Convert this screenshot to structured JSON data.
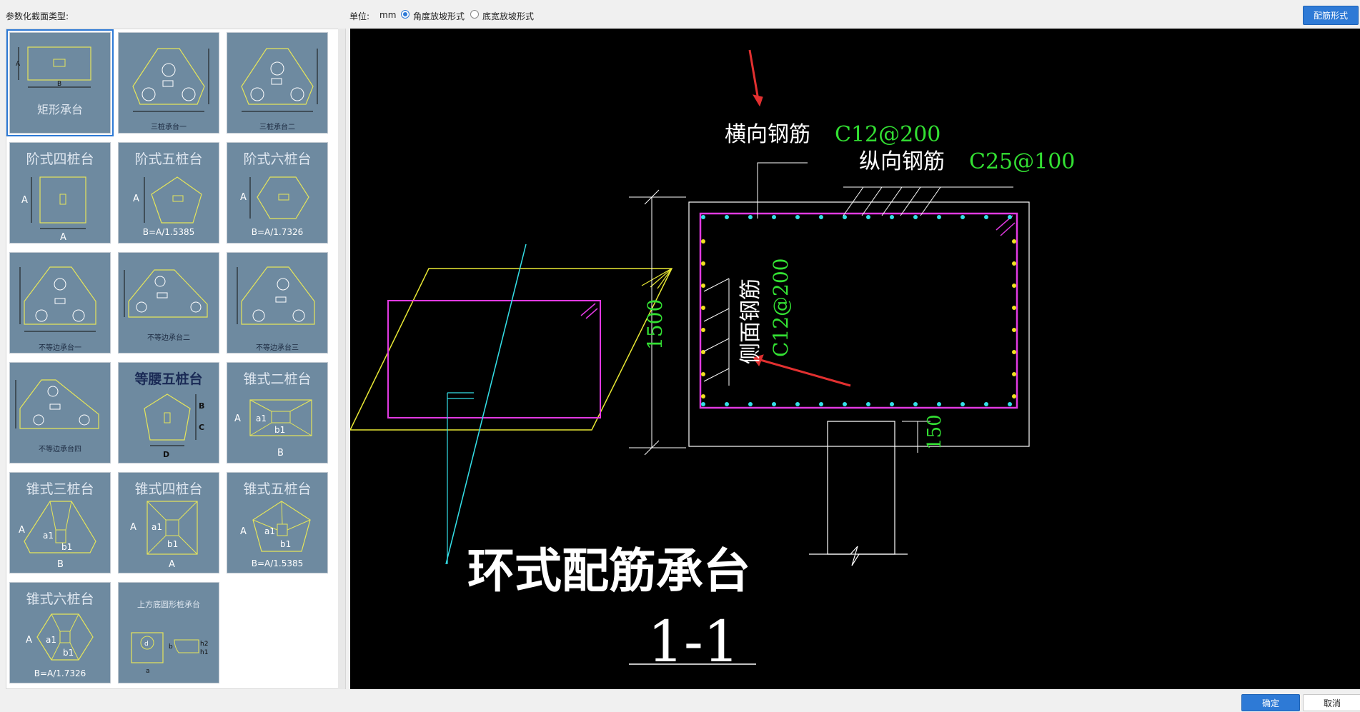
{
  "toolbar": {
    "section_type_label": "参数化截面类型:",
    "unit_label": "单位:",
    "unit_value": "mm",
    "option_angle": "角度放坡形式",
    "option_width": "底宽放坡形式",
    "rebar_form_button": "配筋形式"
  },
  "tiles": [
    {
      "title": "矩形承台"
    },
    {
      "title": "",
      "subtitle": "三桩承台一"
    },
    {
      "title": "",
      "subtitle": "三桩承台二"
    },
    {
      "title": "阶式四桩台",
      "formula": ""
    },
    {
      "title": "阶式五桩台",
      "formula": "B=A/1.5385"
    },
    {
      "title": "阶式六桩台",
      "formula": "B=A/1.7326"
    },
    {
      "title": "",
      "subtitle": "不等边承台一"
    },
    {
      "title": "",
      "subtitle": "不等边承台二"
    },
    {
      "title": "",
      "subtitle": "不等边承台三"
    },
    {
      "title": "",
      "subtitle": "不等边承台四"
    },
    {
      "title": "等腰五桩台"
    },
    {
      "title": "锥式二桩台"
    },
    {
      "title": "锥式三桩台"
    },
    {
      "title": "锥式四桩台"
    },
    {
      "title": "锥式五桩台",
      "formula": "B=A/1.5385"
    },
    {
      "title": "锥式六桩台",
      "formula": "B=A/1.7326"
    },
    {
      "title": "上方底圆形桩承台"
    }
  ],
  "drawing": {
    "transverse_rebar_label": "横向钢筋",
    "transverse_rebar_value": "C12@200",
    "longitudinal_rebar_label": "纵向钢筋",
    "longitudinal_rebar_value": "C25@100",
    "side_rebar_label": "侧面钢筋",
    "side_rebar_value": "C12@200",
    "dim_height": "1500",
    "dim_cover": "150",
    "title": "环式配筋承台",
    "section": "1-1"
  },
  "footer": {
    "ok_button": "确定",
    "cancel_button": "取消"
  }
}
